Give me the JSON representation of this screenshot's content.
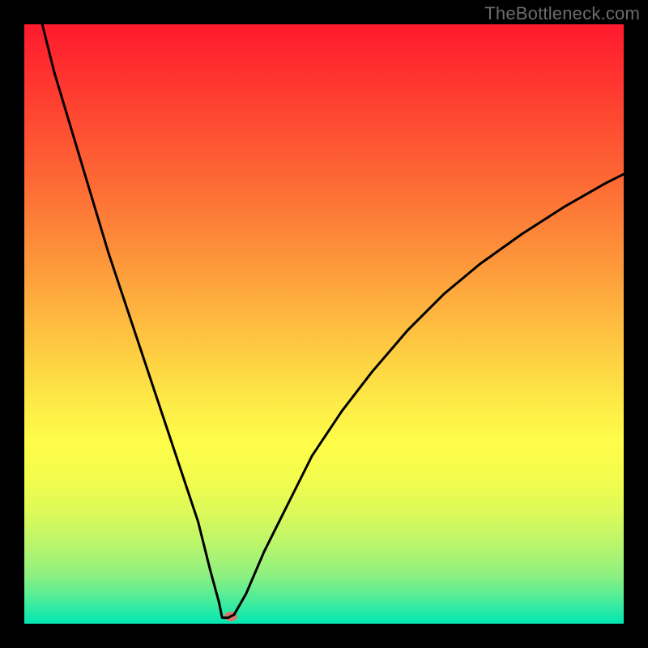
{
  "watermark": "TheBottleneck.com",
  "chart_data": {
    "type": "line",
    "title": "",
    "xlabel": "",
    "ylabel": "",
    "xlim": [
      0,
      100
    ],
    "ylim": [
      0,
      100
    ],
    "grid": false,
    "legend": false,
    "curve_min_x": 33,
    "curve_min_y": 1,
    "marker": {
      "x": 34.5,
      "y": 1.2,
      "color": "#d9786b"
    },
    "colors": {
      "background_top": "#fe1a2d",
      "background_bottom": "#00e7b3",
      "curve": "#000000",
      "frame": "#000000"
    },
    "series": [
      {
        "name": "bottleneck-curve",
        "x": [
          3,
          5,
          8,
          11,
          14,
          17,
          20,
          23,
          26,
          29,
          31,
          32.5,
          33,
          34,
          35,
          37,
          40,
          44,
          48,
          53,
          58,
          64,
          70,
          76,
          83,
          90,
          97,
          100
        ],
        "y": [
          100,
          92,
          82,
          72,
          62,
          53,
          44,
          35,
          26,
          17,
          9,
          3.5,
          1,
          1,
          1.5,
          5,
          12,
          20,
          28,
          35.5,
          42,
          49,
          55,
          60,
          65,
          69.5,
          73.5,
          75
        ]
      }
    ]
  }
}
